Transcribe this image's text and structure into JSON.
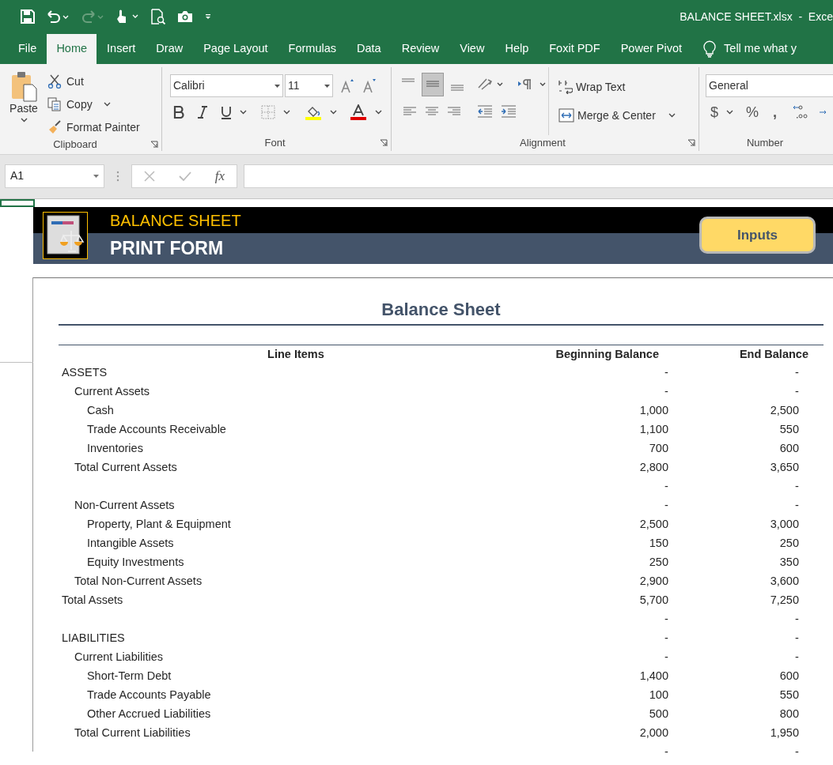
{
  "window": {
    "title": "BALANCE SHEET.xlsx  -  Exce"
  },
  "tabs": [
    {
      "label": "File",
      "selected": false
    },
    {
      "label": "Home",
      "selected": true
    },
    {
      "label": "Insert",
      "selected": false
    },
    {
      "label": "Draw",
      "selected": false
    },
    {
      "label": "Page Layout",
      "selected": false
    },
    {
      "label": "Formulas",
      "selected": false
    },
    {
      "label": "Data",
      "selected": false
    },
    {
      "label": "Review",
      "selected": false
    },
    {
      "label": "View",
      "selected": false
    },
    {
      "label": "Help",
      "selected": false
    },
    {
      "label": "Foxit PDF",
      "selected": false
    },
    {
      "label": "Power Pivot",
      "selected": false
    }
  ],
  "tell_me": {
    "placeholder": "Tell me what y"
  },
  "ribbon": {
    "clipboard": {
      "label": "Clipboard",
      "paste": "Paste",
      "cut": "Cut",
      "copy": "Copy",
      "format_painter": "Format Painter"
    },
    "font": {
      "label": "Font",
      "font_name": "Calibri",
      "font_size": "11"
    },
    "alignment": {
      "label": "Alignment",
      "wrap_text": "Wrap Text",
      "merge_center": "Merge & Center",
      "middle_align_selected": true
    },
    "number": {
      "label": "Number",
      "format": "General",
      "currency": "$",
      "percent": "%",
      "comma": ","
    }
  },
  "formula_bar": {
    "name_box": "A1",
    "function_label": "fx"
  },
  "banner": {
    "title": "BALANCE SHEET",
    "subtitle": "PRINT FORM",
    "button": "Inputs"
  },
  "report": {
    "title": "Balance Sheet",
    "columns": [
      "Line Items",
      "Beginning Balance",
      "End Balance"
    ],
    "rows": [
      {
        "label": "ASSETS",
        "beginning": "-",
        "end": "-",
        "children": [
          {
            "label": "Current Assets",
            "beginning": "-",
            "end": "-",
            "children": [
              {
                "label": "Cash",
                "beginning": "1,000",
                "end": "2,500"
              },
              {
                "label": "Trade Accounts Receivable",
                "beginning": "1,100",
                "end": "550"
              },
              {
                "label": "Inventories",
                "beginning": "700",
                "end": "600"
              }
            ]
          },
          {
            "label": "Total Current Assets",
            "beginning": "2,800",
            "end": "3,650"
          },
          {
            "beginning": "-",
            "end": "-"
          },
          {
            "label": "Non-Current Assets",
            "beginning": "-",
            "end": "-",
            "children": [
              {
                "label": "Property, Plant & Equipment",
                "beginning": "2,500",
                "end": "3,000"
              },
              {
                "label": "Intangible Assets",
                "beginning": "150",
                "end": "250"
              },
              {
                "label": "Equity Investments",
                "beginning": "250",
                "end": "350"
              }
            ]
          },
          {
            "label": "Total Non-Current Assets",
            "beginning": "2,900",
            "end": "3,600"
          }
        ]
      },
      {
        "label": "Total Assets",
        "beginning": "5,700",
        "end": "7,250"
      },
      {
        "beginning": "-",
        "end": "-"
      },
      {
        "label": "LIABILITIES",
        "beginning": "-",
        "end": "-",
        "children": [
          {
            "label": "Current Liabilities",
            "beginning": "-",
            "end": "-",
            "children": [
              {
                "label": "Short-Term Debt",
                "beginning": "1,400",
                "end": "600"
              },
              {
                "label": "Trade Accounts Payable",
                "beginning": "100",
                "end": "550"
              },
              {
                "label": "Other Accrued Liabilities",
                "beginning": "500",
                "end": "800"
              }
            ]
          },
          {
            "label": "Total Current Liabilities",
            "beginning": "2,000",
            "end": "1,950"
          },
          {
            "beginning": "-",
            "end": "-"
          }
        ]
      }
    ]
  }
}
